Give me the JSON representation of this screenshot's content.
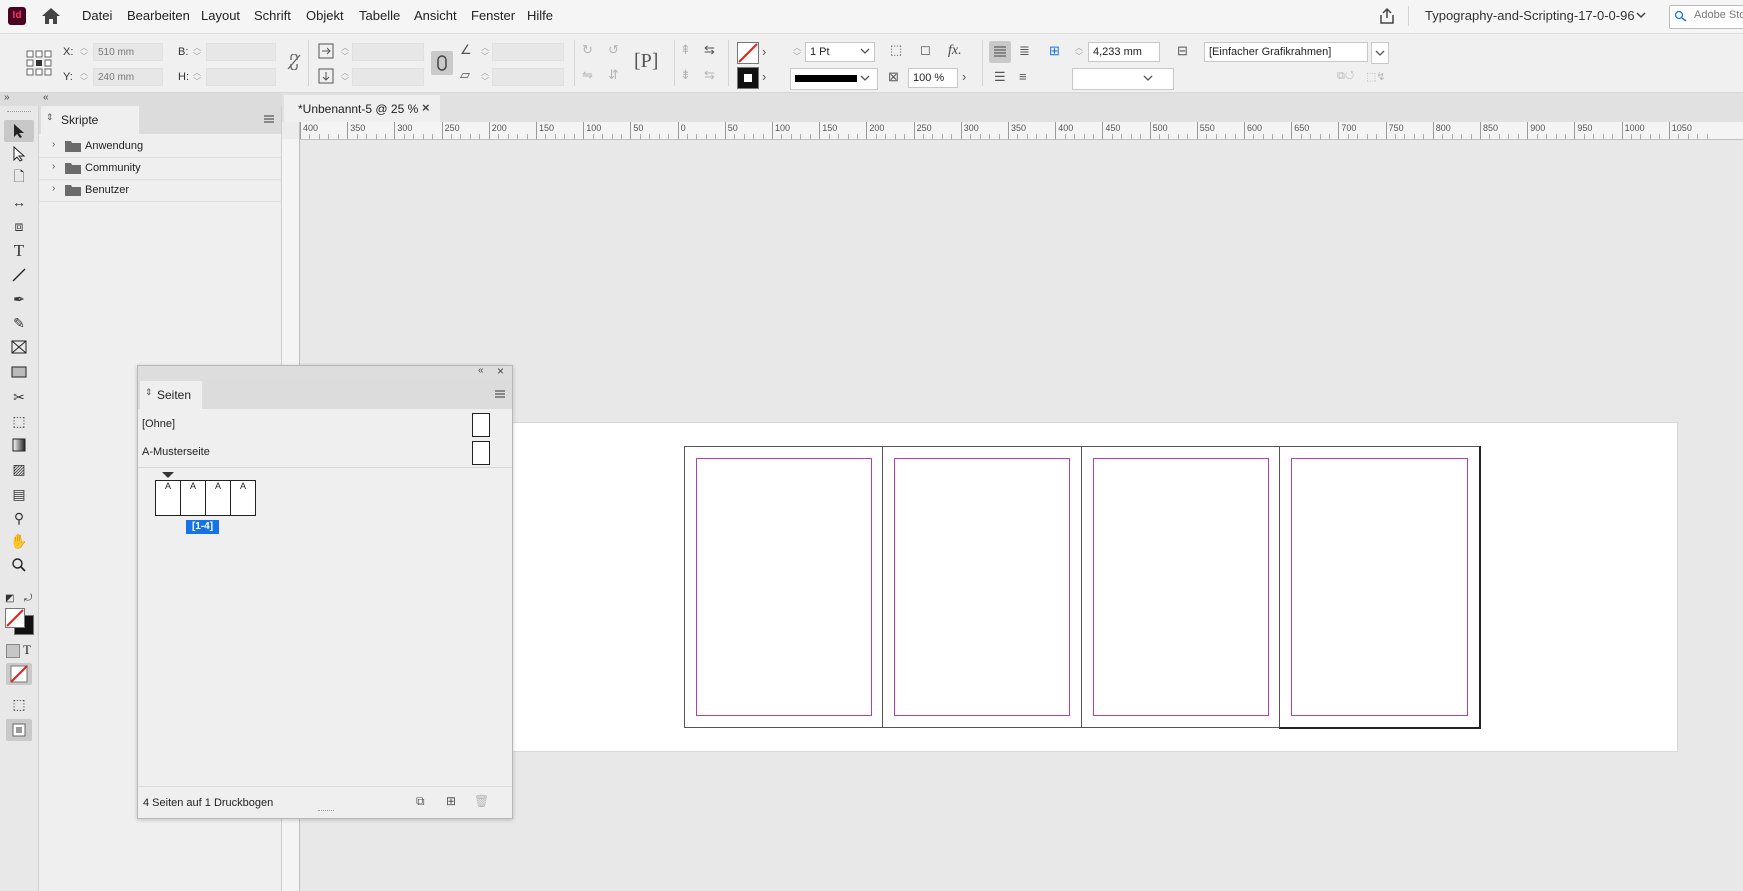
{
  "app": {
    "logo": "Id"
  },
  "menu": [
    "Datei",
    "Bearbeiten",
    "Layout",
    "Schrift",
    "Objekt",
    "Tabelle",
    "Ansicht",
    "Fenster",
    "Hilfe"
  ],
  "workspace_title": "Typography-and-Scripting-17-0-0-96",
  "search_placeholder": "Adobe Sto",
  "control": {
    "x_label": "X:",
    "x_value": "510 mm",
    "y_label": "Y:",
    "y_value": "240 mm",
    "b_label": "B:",
    "h_label": "H:",
    "stroke_weight": "1 Pt",
    "opacity": "100 %",
    "offset_value": "4,233 mm",
    "object_style": "[Einfacher Grafikrahmen]"
  },
  "scripts_panel": {
    "title": "Skripte",
    "folders": [
      "Anwendung",
      "Community",
      "Benutzer"
    ]
  },
  "document_tab": {
    "label": "*Unbenannt-5 @ 25 %",
    "close": "×"
  },
  "ruler_labels": [
    "400",
    "350",
    "300",
    "250",
    "200",
    "150",
    "100",
    "50",
    "0",
    "50",
    "100",
    "150",
    "200",
    "250",
    "300",
    "350",
    "400",
    "450",
    "500",
    "550",
    "600",
    "650",
    "700",
    "750",
    "800",
    "850",
    "900",
    "950",
    "1000",
    "1050"
  ],
  "pages_panel": {
    "title": "Seiten",
    "masters": [
      "[Ohne]",
      "A-Musterseite"
    ],
    "page_letters": [
      "A",
      "A",
      "A",
      "A"
    ],
    "spread_label": "[1-4]",
    "status": "4 Seiten auf 1 Druckbogen"
  }
}
